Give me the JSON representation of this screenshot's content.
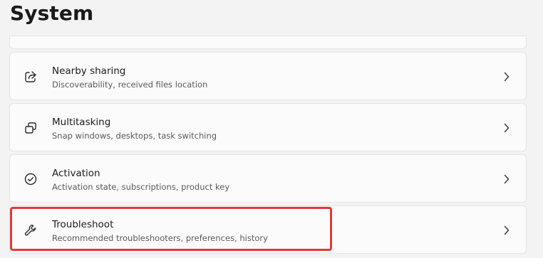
{
  "page": {
    "title": "System"
  },
  "items": [
    {
      "title": "Nearby sharing",
      "description": "Discoverability, received files location",
      "icon": "share-icon"
    },
    {
      "title": "Multitasking",
      "description": "Snap windows, desktops, task switching",
      "icon": "multitasking-icon"
    },
    {
      "title": "Activation",
      "description": "Activation state, subscriptions, product key",
      "icon": "checkmark-circle-icon"
    },
    {
      "title": "Troubleshoot",
      "description": "Recommended troubleshooters, preferences, history",
      "icon": "wrench-icon"
    }
  ],
  "colors": {
    "background": "#f3f3f3",
    "card": "#fbfbfb",
    "highlight": "#e03a3a"
  }
}
